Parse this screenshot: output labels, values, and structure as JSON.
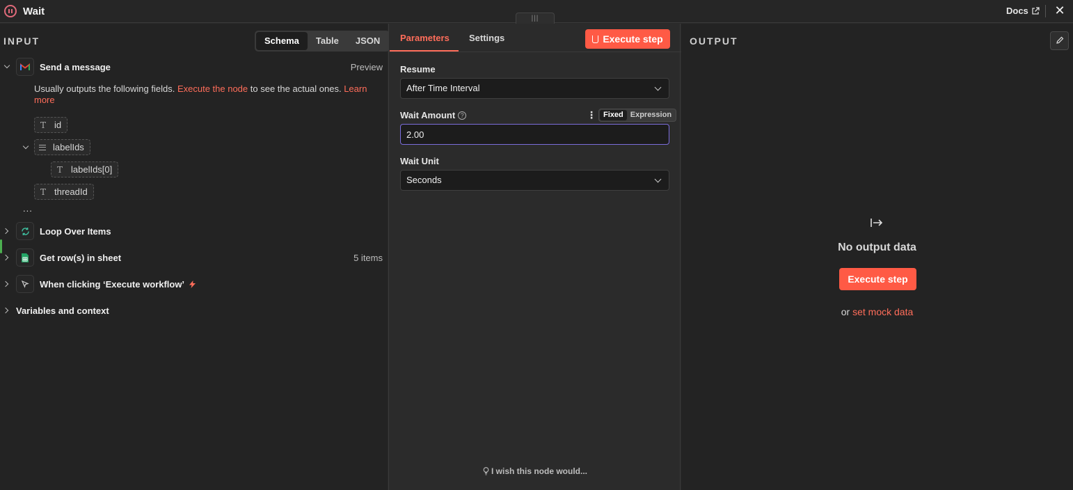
{
  "header": {
    "title": "Wait",
    "docs_label": "Docs",
    "close_glyph": "✕",
    "handle_glyph": "|||"
  },
  "input": {
    "heading": "INPUT",
    "view_tabs": [
      "Schema",
      "Table",
      "JSON"
    ],
    "active_view": "Schema",
    "nodes": [
      {
        "label": "Send a message",
        "meta": "Preview",
        "icon": "gmail-icon",
        "expanded": true
      },
      {
        "label": "Loop Over Items",
        "meta": "",
        "icon": "loop-icon",
        "expanded": false
      },
      {
        "label": "Get row(s) in sheet",
        "meta": "5 items",
        "icon": "google-sheets-icon",
        "expanded": false
      },
      {
        "label": "When clicking ‘Execute workflow’",
        "meta": "",
        "icon": "cursor-icon",
        "expanded": false
      }
    ],
    "hint_prefix": "Usually outputs the following fields. ",
    "hint_link1": "Execute the node",
    "hint_middle": " to see the actual ones. ",
    "hint_link2": "Learn more",
    "fields": [
      {
        "name": "id",
        "type": "string"
      },
      {
        "name": "labelIds",
        "type": "array"
      },
      {
        "name": "labelIds[0]",
        "type": "string"
      },
      {
        "name": "threadId",
        "type": "string"
      }
    ],
    "ellipsis": "...",
    "variables_label": "Variables and context"
  },
  "parameters": {
    "tabs": [
      "Parameters",
      "Settings"
    ],
    "active_tab": "Parameters",
    "execute_label": "Execute step",
    "resume": {
      "label": "Resume",
      "value": "After Time Interval"
    },
    "wait_amount": {
      "label": "Wait Amount",
      "value": "2.00",
      "modes": [
        "Fixed",
        "Expression"
      ],
      "active_mode": "Fixed"
    },
    "wait_unit": {
      "label": "Wait Unit",
      "value": "Seconds"
    },
    "feedback": "I wish this node would..."
  },
  "output": {
    "heading": "OUTPUT",
    "empty_title": "No output data",
    "execute_label": "Execute step",
    "or_text": "or ",
    "mock_link": "set mock data"
  },
  "colors": {
    "accent": "#ff6d5a",
    "button": "#ff5a45",
    "focus_border": "#7b6ddb"
  }
}
